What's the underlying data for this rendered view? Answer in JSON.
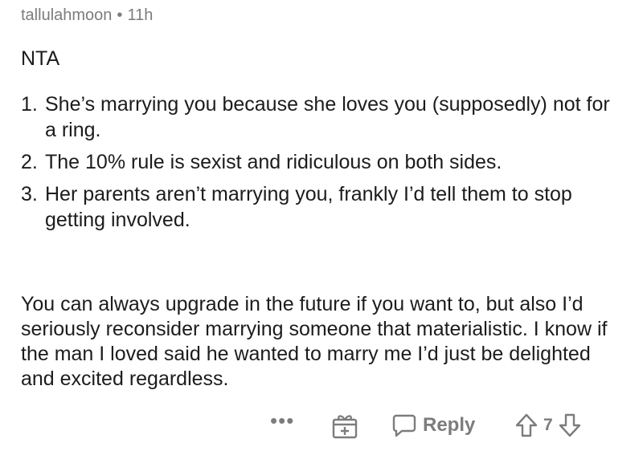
{
  "comment": {
    "author": "tallulahmoon",
    "separator": "•",
    "age": "11h",
    "verdict": "NTA",
    "points": [
      {
        "num": "1.",
        "text": "She’s marrying you because she loves you (supposedly) not for a ring."
      },
      {
        "num": "2.",
        "text": "The 10% rule is sexist and ridiculous on both sides."
      },
      {
        "num": "3.",
        "text": "Her parents aren’t marrying you, frankly I’d tell them to stop getting involved."
      }
    ],
    "paragraph": "You can always upgrade in the future if you want to, but also I’d seriously reconsider marrying someone that materialistic. I know if the man I loved said he wanted to marry me I’d just be delighted and excited regardless."
  },
  "actions": {
    "more_label": "•••",
    "reply_label": "Reply",
    "score": "7",
    "icons": {
      "more": "more-options-icon",
      "award": "award-gift-icon",
      "reply": "reply-bubble-icon",
      "upvote": "upvote-arrow-icon",
      "downvote": "downvote-arrow-icon"
    }
  }
}
